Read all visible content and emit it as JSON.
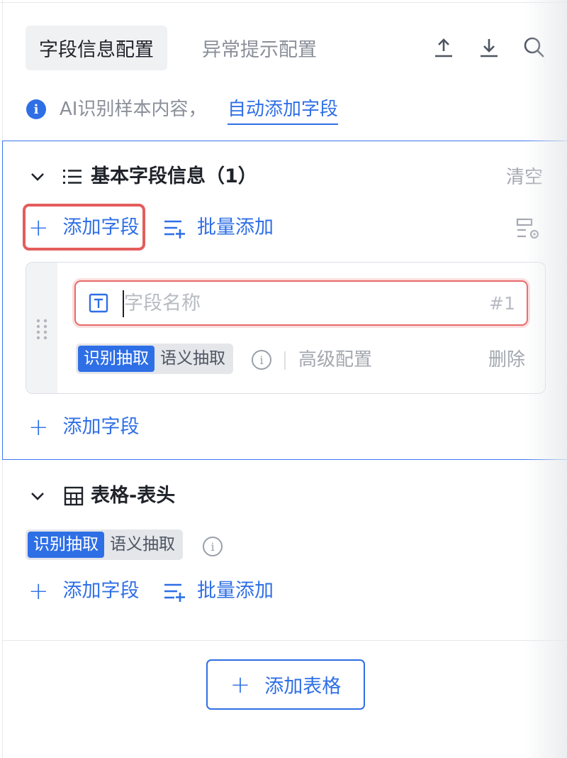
{
  "tabs": {
    "active": "字段信息配置",
    "inactive": "异常提示配置"
  },
  "toolbar": {
    "icons": [
      "upload-icon",
      "download-icon",
      "search-icon"
    ]
  },
  "info": {
    "text": "AI识别样本内容，",
    "link": "自动添加字段"
  },
  "basic_section": {
    "title": "基本字段信息（1）",
    "clear": "清空",
    "add_field": "添加字段",
    "batch_add": "批量添加",
    "field": {
      "placeholder": "字段名称",
      "index": "#1",
      "mode_options": [
        "识别抽取",
        "语义抽取"
      ],
      "mode_selected": "识别抽取",
      "advanced": "高级配置",
      "delete": "删除"
    },
    "add_field_bottom": "添加字段"
  },
  "table_section": {
    "title": "表格-表头",
    "mode_options": [
      "识别抽取",
      "语义抽取"
    ],
    "mode_selected": "识别抽取",
    "add_field": "添加字段",
    "batch_add": "批量添加"
  },
  "add_table_button": "添加表格",
  "colors": {
    "accent": "#2f6fe6",
    "highlight_red": "#e45d5d",
    "muted": "#a3a8b0"
  }
}
